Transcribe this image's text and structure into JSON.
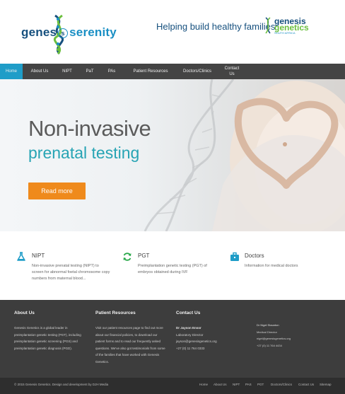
{
  "header": {
    "logo": {
      "part1": "genes",
      "part2": "s",
      "part3": "serenity"
    },
    "tagline": "Helping build healthy families",
    "brand": {
      "line1": "genesis",
      "line2": "genetics",
      "sub": "SOUTH AFRICA"
    }
  },
  "nav": {
    "items": [
      {
        "label": "Home"
      },
      {
        "label": "About Us"
      },
      {
        "label": "NIPT"
      },
      {
        "label": "PaT"
      },
      {
        "label": "PAs"
      },
      {
        "label": "Patient Resources"
      },
      {
        "label": "Doctors/Clinics"
      },
      {
        "label": "Contact Us"
      }
    ]
  },
  "hero": {
    "title1": "Non-invasive",
    "title2": "prenatal testing",
    "button": "Read more"
  },
  "features": [
    {
      "icon": "flask-icon",
      "title": "NIPT",
      "desc": "Non-invasive prenatal testing (NIPT) to screen for abnormal foetal chromosome copy numbers from maternal blood..."
    },
    {
      "icon": "refresh-icon",
      "title": "PGT",
      "desc": "Preimplantation genetic testing (PGT) of embryos obtained during IVF"
    },
    {
      "icon": "briefcase-icon",
      "title": "Doctors",
      "desc": "Information for medical doctors"
    }
  ],
  "footer": {
    "about_head": "About Us",
    "about_text": "Genesis Genetics is a global leader in preimplantation genetic testing (PGT), including preimplantation genetic screening (PGS) and preimplantation genetic diagnosis (PGD).",
    "resources_head": "Patient Resources",
    "resources_text": "Visit our patient resources page to find out more about our financial policies, to download our patient forms and to read our frequently asked questions. We've also got testimonials from some of the families that have worked with Genesis Genetics.",
    "contact_head": "Contact Us",
    "contact_name": "Dr Jayson Ensor",
    "contact_role": "Laboratory Director",
    "contact_email": "jayson@genesisgenetics.org",
    "contact_phone": "+27 (0) 11 764 0333",
    "extra_lines": [
      "Dr Nigel Staunton",
      "Medical Director",
      "nigel@genesisgenetics.org",
      "+27 (0) 11 764 4434"
    ],
    "copyright": "© 2015 Genesis Genetics. Design and development by DJH Media",
    "links": [
      "Home",
      "About Us",
      "NIPT",
      "PAS",
      "PGT",
      "Doctors/Clinics",
      "Contact Us",
      "Sitemap"
    ]
  }
}
